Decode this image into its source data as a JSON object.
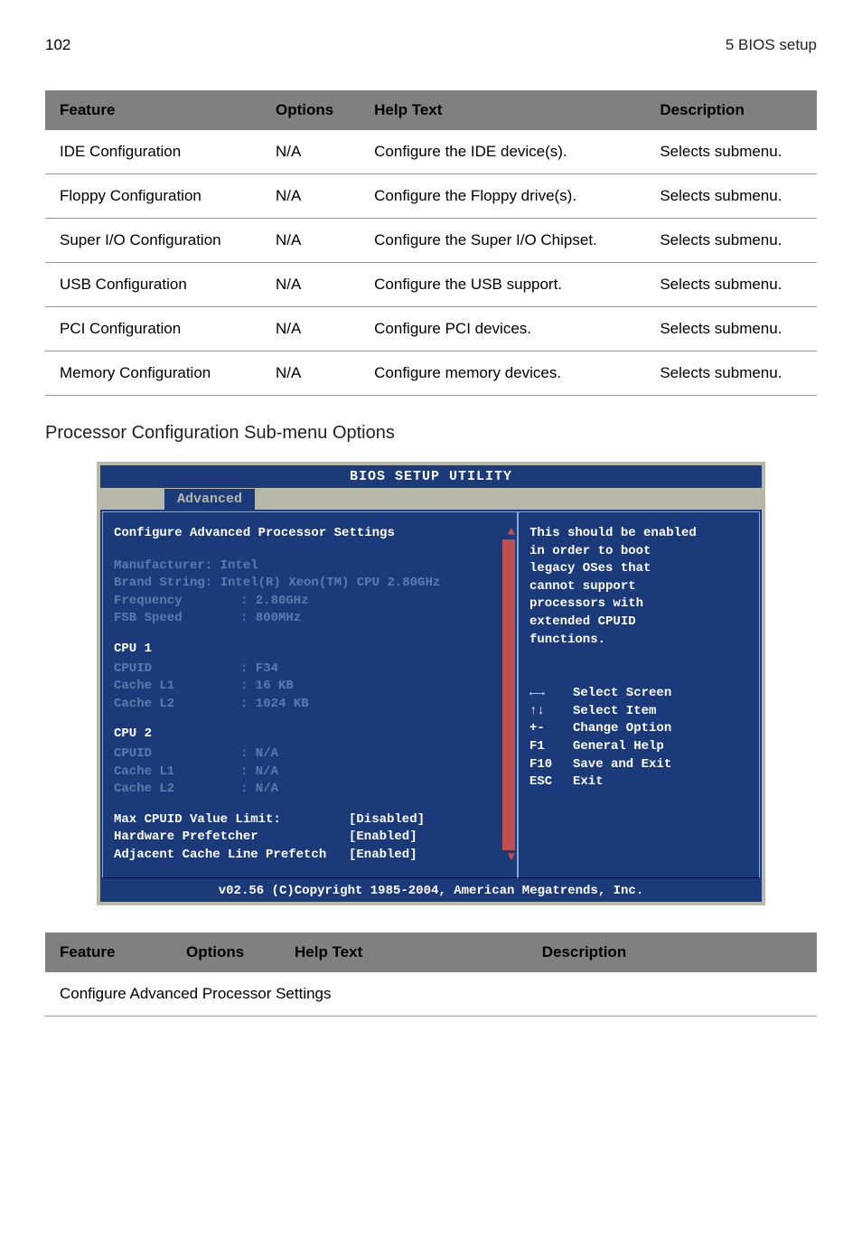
{
  "header": {
    "page": "102",
    "section": "5 BIOS setup"
  },
  "table1": {
    "headers": [
      "Feature",
      "Options",
      "Help Text",
      "Description"
    ],
    "rows": [
      {
        "feature": "IDE Configuration",
        "options": "N/A",
        "help": "Configure the IDE device(s).",
        "desc": "Selects submenu."
      },
      {
        "feature": "Floppy Configuration",
        "options": "N/A",
        "help": "Configure the Floppy drive(s).",
        "desc": "Selects submenu."
      },
      {
        "feature": "Super I/O Configuration",
        "options": "N/A",
        "help": "Configure the Super I/O Chipset.",
        "desc": "Selects submenu."
      },
      {
        "feature": "USB Configuration",
        "options": "N/A",
        "help": "Configure the USB support.",
        "desc": "Selects submenu."
      },
      {
        "feature": "PCI Configuration",
        "options": "N/A",
        "help": "Configure PCI devices.",
        "desc": "Selects submenu."
      },
      {
        "feature": "Memory Configuration",
        "options": "N/A",
        "help": "Configure memory devices.",
        "desc": "Selects submenu."
      }
    ]
  },
  "subheading": "Processor Configuration Sub-menu Options",
  "bios": {
    "title": "BIOS SETUP UTILITY",
    "tab": "Advanced",
    "heading1": "Configure Advanced Processor Settings",
    "info": {
      "manufacturer": "Manufacturer: Intel",
      "brand": "Brand String: Intel(R) Xeon(TM) CPU 2.80GHz",
      "freq_label": "Frequency",
      "freq_val": ": 2.80GHz",
      "fsb_label": "FSB Speed",
      "fsb_val": ": 800MHz"
    },
    "cpu1": {
      "title": "CPU 1",
      "cpuid_label": "CPUID",
      "cpuid_val": ": F34",
      "l1_label": "Cache L1",
      "l1_val": ":   16 KB",
      "l2_label": "Cache L2",
      "l2_val": ": 1024 KB"
    },
    "cpu2": {
      "title": "CPU 2",
      "cpuid_label": "CPUID",
      "cpuid_val": ": N/A",
      "l1_label": "Cache L1",
      "l1_val": ": N/A",
      "l2_label": "Cache L2",
      "l2_val": ": N/A"
    },
    "options": {
      "max_label": "Max CPUID Value Limit:",
      "max_val": "[Disabled]",
      "hw_label": "Hardware Prefetcher",
      "hw_val": "[Enabled]",
      "adj_label": "Adjacent Cache Line Prefetch",
      "adj_val": "[Enabled]"
    },
    "help": {
      "l1": "This should be enabled",
      "l2": "in order to boot",
      "l3": "legacy OSes that",
      "l4": "cannot support",
      "l5": "processors with",
      "l6": "extended CPUID",
      "l7": "functions."
    },
    "keys": {
      "k1": "←→",
      "k1d": "Select Screen",
      "k2": "↑↓",
      "k2d": "Select Item",
      "k3": "+-",
      "k3d": "Change Option",
      "k4": "F1",
      "k4d": "General Help",
      "k5": "F10",
      "k5d": "Save and Exit",
      "k6": "ESC",
      "k6d": "Exit"
    },
    "footer": "v02.56 (C)Copyright 1985-2004, American Megatrends, Inc."
  },
  "table2": {
    "headers": [
      "Feature",
      "Options",
      "Help Text",
      "Description"
    ],
    "row1": "Configure Advanced Processor Settings"
  }
}
